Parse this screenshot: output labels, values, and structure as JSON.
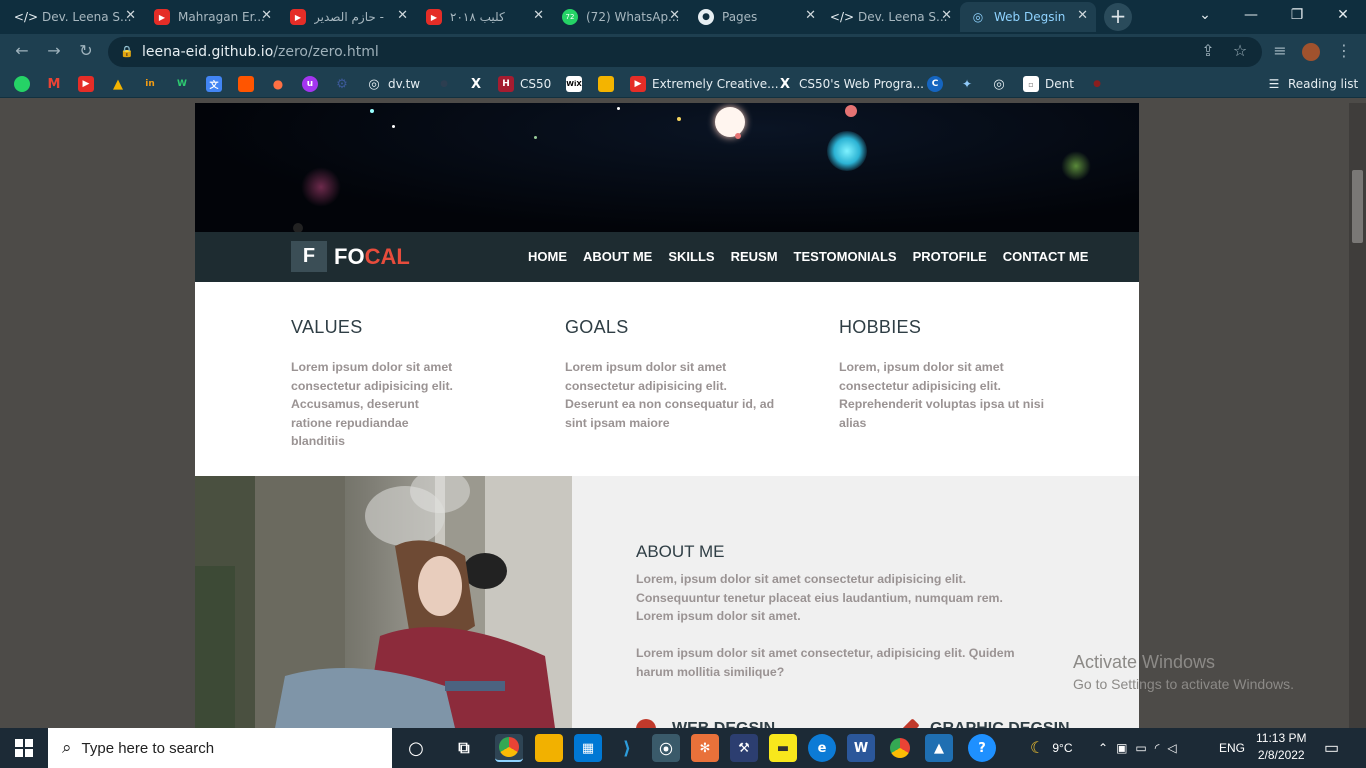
{
  "browser": {
    "tabs": [
      {
        "title": "Dev. Leena S...",
        "icon": "code-icon"
      },
      {
        "title": "Mahragan Er...",
        "icon": "youtube-icon"
      },
      {
        "title": "حازم الصدير -",
        "icon": "youtube-icon"
      },
      {
        "title": "كليب ٢٠١٨",
        "icon": "youtube-icon"
      },
      {
        "title": "(72) WhatsAp...",
        "icon": "whatsapp-icon"
      },
      {
        "title": "Pages",
        "icon": "github-icon"
      },
      {
        "title": "Dev. Leena S...",
        "icon": "code-icon"
      },
      {
        "title": "Web Degsin",
        "icon": "globe-icon",
        "active": true
      }
    ],
    "url_host": "leena-eid.github.io",
    "url_path": "/zero/zero.html",
    "bookmarks": [
      {
        "label": "dv.tw",
        "icon": "globe-icon"
      },
      {
        "label": "CS50",
        "icon": "harvard-icon"
      },
      {
        "label": "Extremely Creative...",
        "icon": "youtube-icon"
      },
      {
        "label": "CS50's Web Progra...",
        "icon": "x-icon"
      },
      {
        "label": "Dent",
        "icon": "doc-icon"
      }
    ],
    "reading_list": "Reading list"
  },
  "site": {
    "logo_letter": "F",
    "logo_part1": "FO",
    "logo_part2": "CAL",
    "menu": [
      "HOME",
      "ABOUT ME",
      "SKILLS",
      "REUSM",
      "TESTOMONIALS",
      "PROTOFILE",
      "CONTACT ME"
    ],
    "columns": [
      {
        "title": "VALUES",
        "text": "Lorem ipsum dolor sit amet consectetur adipisicing elit. Accusamus, deserunt ratione repudiandae blanditiis"
      },
      {
        "title": "GOALS",
        "text": "Lorem ipsum dolor sit amet consectetur adipisicing elit. Deserunt ea non consequatur id, ad sint ipsam maiore"
      },
      {
        "title": "HOBBIES",
        "text": "Lorem, ipsum dolor sit amet consectetur adipisicing elit. Reprehenderit voluptas ipsa ut nisi alias"
      }
    ],
    "about": {
      "title": "ABOUT ME",
      "p1": "Lorem, ipsum dolor sit amet consectetur adipisicing elit. Consequuntur tenetur placeat eius laudantium, numquam rem. Lorem ipsum dolor sit amet.",
      "p2": "Lorem ipsum dolor sit amet consectetur, adipisicing elit. Quidem harum mollitia similique?",
      "skill1": "WEB DEGSIN",
      "skill2": "GRAPHIC DEGSIN"
    }
  },
  "watermark": {
    "line1": "Activate Windows",
    "line2": "Go to Settings to activate Windows."
  },
  "taskbar": {
    "search_placeholder": "Type here to search",
    "weather": "9°C",
    "lang": "ENG",
    "time": "11:13 PM",
    "date": "2/8/2022"
  },
  "colors": {
    "accent": "#e74c3c",
    "nav_bg": "#1e2c31",
    "text_muted": "#9a9393"
  }
}
